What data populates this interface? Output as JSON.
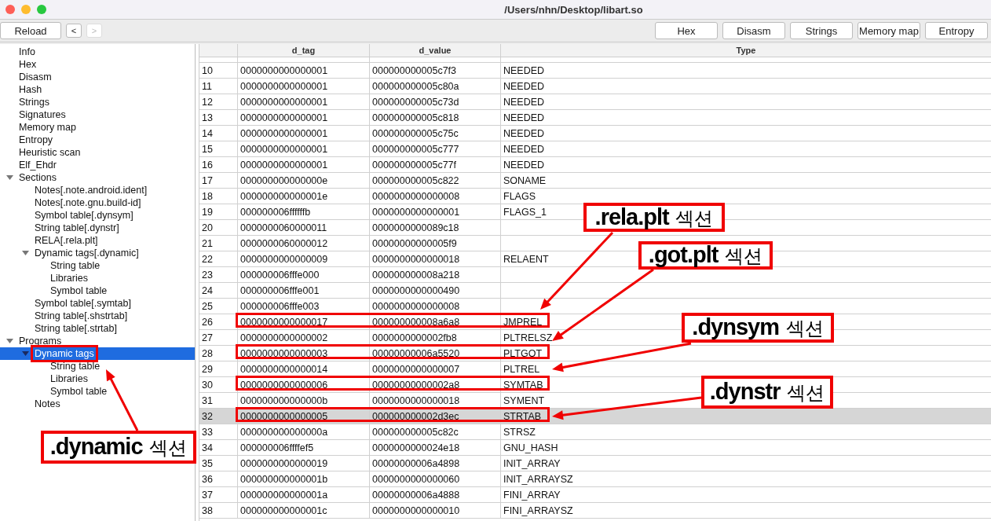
{
  "window": {
    "title": "/Users/nhn/Desktop/libart.so"
  },
  "toolbar": {
    "left": [
      {
        "label": "Reload",
        "disabled": false
      },
      {
        "label": "<",
        "disabled": false
      },
      {
        "label": ">",
        "disabled": true
      }
    ],
    "right": [
      {
        "label": "Hex"
      },
      {
        "label": "Disasm"
      },
      {
        "label": "Strings"
      },
      {
        "label": "Memory map"
      },
      {
        "label": "Entropy"
      }
    ]
  },
  "sidebar": {
    "items": [
      {
        "label": "Info",
        "selected": false,
        "highlighted": false
      },
      {
        "label": "Hex",
        "selected": false,
        "highlighted": false
      },
      {
        "label": "Disasm",
        "selected": false,
        "highlighted": false
      },
      {
        "label": "Hash",
        "selected": false,
        "highlighted": false
      },
      {
        "label": "Strings",
        "selected": false,
        "highlighted": false
      },
      {
        "label": "Signatures",
        "selected": false,
        "highlighted": false
      },
      {
        "label": "Memory map",
        "selected": false,
        "highlighted": false
      },
      {
        "label": "Entropy",
        "selected": false,
        "highlighted": false
      },
      {
        "label": "Heuristic scan",
        "selected": false,
        "highlighted": false
      },
      {
        "label": "Elf_Ehdr",
        "selected": false,
        "highlighted": false
      },
      {
        "label": "Sections",
        "selected": false,
        "highlighted": false,
        "expanded": true,
        "children": [
          {
            "label": "Notes[.note.android.ident]",
            "selected": false,
            "highlighted": false
          },
          {
            "label": "Notes[.note.gnu.build-id]",
            "selected": false,
            "highlighted": false
          },
          {
            "label": "Symbol table[.dynsym]",
            "selected": false,
            "highlighted": false
          },
          {
            "label": "String table[.dynstr]",
            "selected": false,
            "highlighted": false
          },
          {
            "label": "RELA[.rela.plt]",
            "selected": false,
            "highlighted": false
          },
          {
            "label": "Dynamic tags[.dynamic]",
            "selected": false,
            "highlighted": false,
            "expanded": true,
            "children": [
              {
                "label": "String table",
                "selected": false,
                "highlighted": false
              },
              {
                "label": "Libraries",
                "selected": false,
                "highlighted": false
              },
              {
                "label": "Symbol table",
                "selected": false,
                "highlighted": false
              }
            ]
          },
          {
            "label": "Symbol table[.symtab]",
            "selected": false,
            "highlighted": false
          },
          {
            "label": "String table[.shstrtab]",
            "selected": false,
            "highlighted": false
          },
          {
            "label": "String table[.strtab]",
            "selected": false,
            "highlighted": false
          }
        ]
      },
      {
        "label": "Programs",
        "selected": false,
        "highlighted": false,
        "expanded": true,
        "children": [
          {
            "label": "Dynamic tags",
            "selected": true,
            "highlighted": true,
            "expanded": true,
            "children": [
              {
                "label": "String table",
                "selected": false,
                "highlighted": false
              },
              {
                "label": "Libraries",
                "selected": false,
                "highlighted": false
              },
              {
                "label": "Symbol table",
                "selected": false,
                "highlighted": false
              }
            ]
          },
          {
            "label": "Notes",
            "selected": false,
            "highlighted": false
          }
        ]
      }
    ]
  },
  "table": {
    "columns": [
      "d_tag",
      "d_value",
      "Type"
    ],
    "rows": [
      {
        "index": "10",
        "d_tag": "0000000000000001",
        "d_value": "000000000005c7f3",
        "type": "NEEDED",
        "selected": false,
        "highlighted": false
      },
      {
        "index": "11",
        "d_tag": "0000000000000001",
        "d_value": "000000000005c80a",
        "type": "NEEDED",
        "selected": false,
        "highlighted": false
      },
      {
        "index": "12",
        "d_tag": "0000000000000001",
        "d_value": "000000000005c73d",
        "type": "NEEDED",
        "selected": false,
        "highlighted": false
      },
      {
        "index": "13",
        "d_tag": "0000000000000001",
        "d_value": "000000000005c818",
        "type": "NEEDED",
        "selected": false,
        "highlighted": false
      },
      {
        "index": "14",
        "d_tag": "0000000000000001",
        "d_value": "000000000005c75c",
        "type": "NEEDED",
        "selected": false,
        "highlighted": false
      },
      {
        "index": "15",
        "d_tag": "0000000000000001",
        "d_value": "000000000005c777",
        "type": "NEEDED",
        "selected": false,
        "highlighted": false
      },
      {
        "index": "16",
        "d_tag": "0000000000000001",
        "d_value": "000000000005c77f",
        "type": "NEEDED",
        "selected": false,
        "highlighted": false
      },
      {
        "index": "17",
        "d_tag": "000000000000000e",
        "d_value": "000000000005c822",
        "type": "SONAME",
        "selected": false,
        "highlighted": false
      },
      {
        "index": "18",
        "d_tag": "000000000000001e",
        "d_value": "0000000000000008",
        "type": "FLAGS",
        "selected": false,
        "highlighted": false
      },
      {
        "index": "19",
        "d_tag": "000000006ffffffb",
        "d_value": "0000000000000001",
        "type": "FLAGS_1",
        "selected": false,
        "highlighted": false
      },
      {
        "index": "20",
        "d_tag": "0000000060000011",
        "d_value": "0000000000089c18",
        "selected": false,
        "highlighted": false
      },
      {
        "index": "21",
        "d_tag": "0000000060000012",
        "d_value": "00000000000005f9",
        "selected": false,
        "highlighted": false
      },
      {
        "index": "22",
        "d_tag": "0000000000000009",
        "d_value": "0000000000000018",
        "type": "RELAENT",
        "selected": false,
        "highlighted": false
      },
      {
        "index": "23",
        "d_tag": "000000006fffe000",
        "d_value": "000000000008a218",
        "selected": false,
        "highlighted": false
      },
      {
        "index": "24",
        "d_tag": "000000006fffe001",
        "d_value": "0000000000000490",
        "selected": false,
        "highlighted": false
      },
      {
        "index": "25",
        "d_tag": "000000006fffe003",
        "d_value": "0000000000000008",
        "selected": false,
        "highlighted": false
      },
      {
        "index": "26",
        "d_tag": "0000000000000017",
        "d_value": "000000000008a6a8",
        "type": "JMPREL",
        "selected": false,
        "highlighted": true
      },
      {
        "index": "27",
        "d_tag": "0000000000000002",
        "d_value": "0000000000002fb8",
        "type": "PLTRELSZ",
        "selected": false,
        "highlighted": false
      },
      {
        "index": "28",
        "d_tag": "0000000000000003",
        "d_value": "00000000006a5520",
        "type": "PLTGOT",
        "selected": false,
        "highlighted": true
      },
      {
        "index": "29",
        "d_tag": "0000000000000014",
        "d_value": "0000000000000007",
        "type": "PLTREL",
        "selected": false,
        "highlighted": false
      },
      {
        "index": "30",
        "d_tag": "0000000000000006",
        "d_value": "00000000000002a8",
        "type": "SYMTAB",
        "selected": false,
        "highlighted": true
      },
      {
        "index": "31",
        "d_tag": "000000000000000b",
        "d_value": "0000000000000018",
        "type": "SYMENT",
        "selected": false,
        "highlighted": false
      },
      {
        "index": "32",
        "d_tag": "0000000000000005",
        "d_value": "000000000002d3ec",
        "type": "STRTAB",
        "selected": true,
        "highlighted": true
      },
      {
        "index": "33",
        "d_tag": "000000000000000a",
        "d_value": "000000000005c82c",
        "type": "STRSZ",
        "selected": false,
        "highlighted": false
      },
      {
        "index": "34",
        "d_tag": "000000006ffffef5",
        "d_value": "0000000000024e18",
        "type": "GNU_HASH",
        "selected": false,
        "highlighted": false
      },
      {
        "index": "35",
        "d_tag": "0000000000000019",
        "d_value": "00000000006a4898",
        "type": "INIT_ARRAY",
        "selected": false,
        "highlighted": false
      },
      {
        "index": "36",
        "d_tag": "000000000000001b",
        "d_value": "0000000000000060",
        "type": "INIT_ARRAYSZ",
        "selected": false,
        "highlighted": false
      },
      {
        "index": "37",
        "d_tag": "000000000000001a",
        "d_value": "00000000006a4888",
        "type": "FINI_ARRAY",
        "selected": false,
        "highlighted": false
      },
      {
        "index": "38",
        "d_tag": "000000000000001c",
        "d_value": "0000000000000010",
        "type": "FINI_ARRAYSZ",
        "selected": false,
        "highlighted": false
      }
    ]
  },
  "callouts": [
    {
      "label": "**.rela.plt** 섹션"
    },
    {
      "label": "**.got.plt** 섹션"
    },
    {
      "label": "**.dynsym** 섹션"
    },
    {
      "label": "**.dynstr** 섹션"
    },
    {
      "label": "**.dynamic** 섹션"
    }
  ]
}
